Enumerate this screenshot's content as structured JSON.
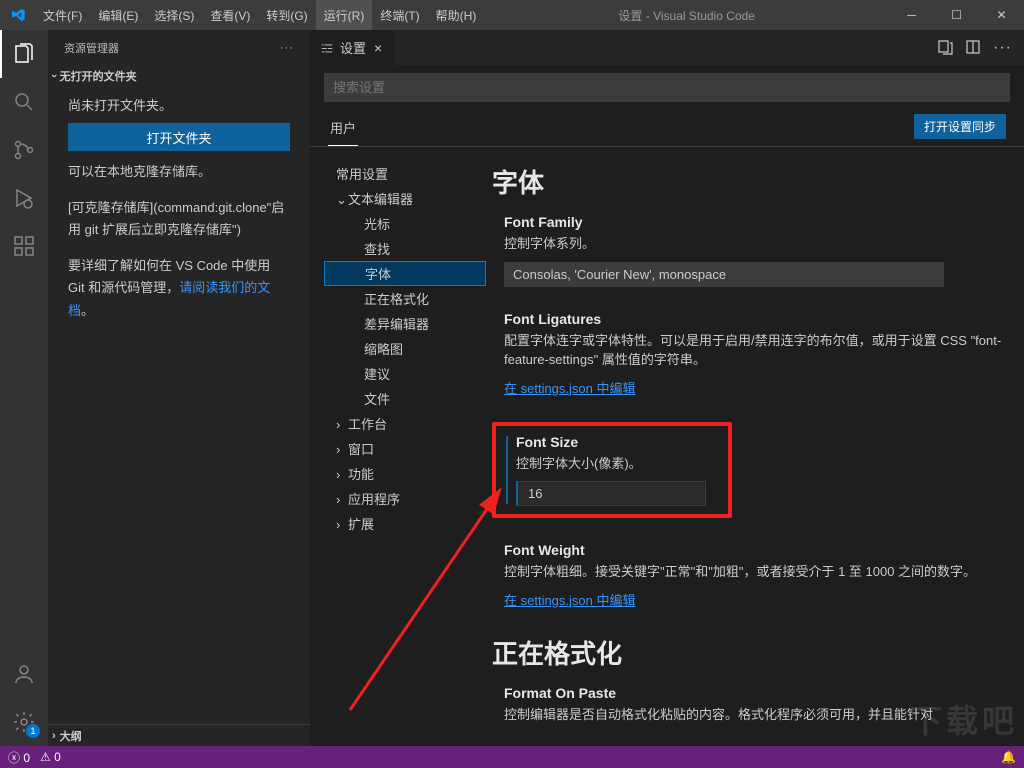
{
  "titlebar": {
    "menus": [
      "文件(F)",
      "编辑(E)",
      "选择(S)",
      "查看(V)",
      "转到(G)",
      "运行(R)",
      "终端(T)",
      "帮助(H)"
    ],
    "title": "设置 - Visual Studio Code"
  },
  "sidebar": {
    "title": "资源管理器",
    "section": "无打开的文件夹",
    "line1": "尚未打开文件夹。",
    "open_folder": "打开文件夹",
    "line2": "可以在本地克隆存储库。",
    "line3a": "[可",
    "line3_link": "克隆存储库](command:git.clone\"启用 git 扩展后立即克隆存储库\")",
    "line4a": "要详细了解如何在 VS Code 中使用 Git 和源代码管理，",
    "line4_link": "请阅读我们的文档",
    "line4b": "。",
    "outline": "大纲"
  },
  "tab": {
    "label": "设置"
  },
  "settings": {
    "search_placeholder": "搜索设置",
    "tab_user": "用户",
    "sync_button": "打开设置同步",
    "toc": {
      "common": "常用设置",
      "text_editor": "文本编辑器",
      "cursor": "光标",
      "find": "查找",
      "font": "字体",
      "formatting": "正在格式化",
      "diff": "差异编辑器",
      "minimap": "缩略图",
      "suggest": "建议",
      "files": "文件",
      "workbench": "工作台",
      "window": "窗口",
      "features": "功能",
      "application": "应用程序",
      "extensions": "扩展"
    },
    "section_font": "字体",
    "font_family": {
      "title": "Font Family",
      "desc": "控制字体系列。",
      "value": "Consolas, 'Courier New', monospace"
    },
    "font_ligatures": {
      "title": "Font Ligatures",
      "desc": "配置字体连字或字体特性。可以是用于启用/禁用连字的布尔值，或用于设置 CSS \"font-feature-settings\" 属性值的字符串。",
      "link": "在 settings.json 中编辑"
    },
    "font_size": {
      "title": "Font Size",
      "desc": "控制字体大小(像素)。",
      "value": "16"
    },
    "font_weight": {
      "title": "Font Weight",
      "desc": "控制字体粗细。接受关键字\"正常\"和\"加粗\"，或者接受介于 1 至 1000 之间的数字。",
      "link": "在 settings.json 中编辑"
    },
    "section_formatting": "正在格式化",
    "format_on_paste": {
      "title": "Format On Paste",
      "desc": "控制编辑器是否自动格式化粘贴的内容。格式化程序必须可用，并且能针对"
    }
  },
  "statusbar": {
    "errors": "0",
    "warnings": "0"
  },
  "watermark": "下载吧"
}
